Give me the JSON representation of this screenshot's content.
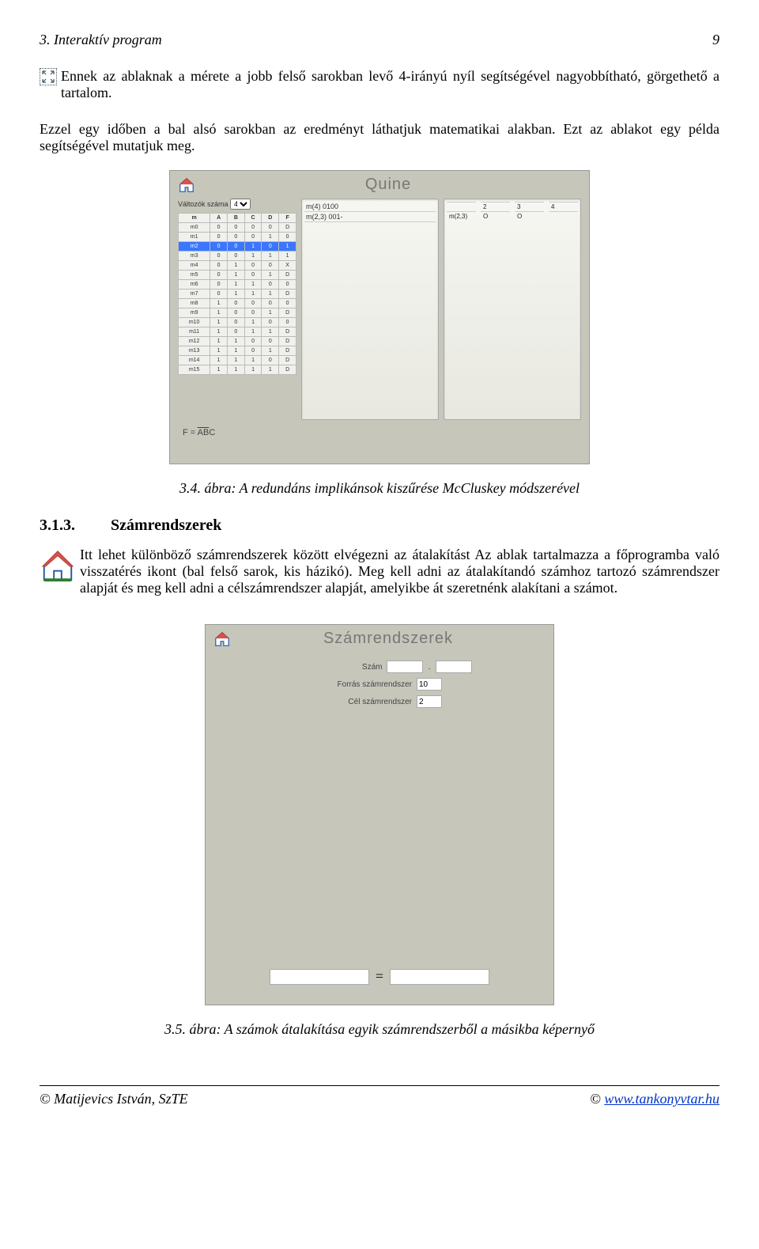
{
  "header": {
    "left": "3. Interaktív program",
    "right": "9"
  },
  "para1": "Ennek az ablaknak a mérete a jobb felső sarokban levő 4-irányú nyíl segítségével nagyobbítható, görgethető a tartalom.",
  "para2": "Ezzel egy időben a bal alsó sarokban az eredményt láthatjuk matematikai alakban. Ezt az ablakot egy példa segítségével mutatjuk meg.",
  "quine": {
    "title": "Quine",
    "var_label": "Változók száma",
    "var_value": "4",
    "truth_headers": [
      "m",
      "A",
      "B",
      "C",
      "D",
      "F"
    ],
    "truth_rows": [
      [
        "m0",
        "0",
        "0",
        "0",
        "0",
        "D"
      ],
      [
        "m1",
        "0",
        "0",
        "0",
        "1",
        "0"
      ],
      [
        "m2",
        "0",
        "0",
        "1",
        "0",
        "1"
      ],
      [
        "m3",
        "0",
        "0",
        "1",
        "1",
        "1"
      ],
      [
        "m4",
        "0",
        "1",
        "0",
        "0",
        "X"
      ],
      [
        "m5",
        "0",
        "1",
        "0",
        "1",
        "D"
      ],
      [
        "m6",
        "0",
        "1",
        "1",
        "0",
        "0"
      ],
      [
        "m7",
        "0",
        "1",
        "1",
        "1",
        "D"
      ],
      [
        "m8",
        "1",
        "0",
        "0",
        "0",
        "0"
      ],
      [
        "m9",
        "1",
        "0",
        "0",
        "1",
        "D"
      ],
      [
        "m10",
        "1",
        "0",
        "1",
        "0",
        "0"
      ],
      [
        "m11",
        "1",
        "0",
        "1",
        "1",
        "D"
      ],
      [
        "m12",
        "1",
        "1",
        "0",
        "0",
        "D"
      ],
      [
        "m13",
        "1",
        "1",
        "0",
        "1",
        "D"
      ],
      [
        "m14",
        "1",
        "1",
        "1",
        "0",
        "D"
      ],
      [
        "m15",
        "1",
        "1",
        "1",
        "1",
        "D"
      ]
    ],
    "highlight_row": 2,
    "panel1_lines": [
      "m(4)  0100",
      "m(2,3)  001-"
    ],
    "panel2_header": [
      "",
      "2",
      "3",
      "4"
    ],
    "panel2_row": [
      "m(2,3)",
      "O",
      "O",
      ""
    ],
    "formula_label": "F  =  ",
    "formula_value_pre_over": "",
    "formula_value_over": "AB",
    "formula_value_post_over": "C"
  },
  "caption1": "3.4. ábra: A redundáns implikánsok kiszűrése McCluskey módszerével",
  "section": {
    "num": "3.1.3.",
    "title": "Számrendszerek"
  },
  "para3": "Itt lehet különböző számrendszerek között elvégezni az átalakítást Az ablak tartalmazza a főprogramba való visszatérés ikont (bal felső sarok, kis házikó). Meg kell adni az átalakítandó számhoz tartozó számrendszer alapját és meg kell adni a célszámrendszer alapját, amelyikbe át szeretnénk alakítani a számot.",
  "szr": {
    "title": "Számrendszerek",
    "label_szam": "Szám",
    "label_forras": "Forrás számrendszer",
    "label_cel": "Cél számrendszer",
    "value_forras": "10",
    "value_cel": "2",
    "equals": "="
  },
  "caption2": "3.5. ábra: A számok átalakítása egyik számrendszerből a másikba képernyő",
  "footer": {
    "left": "© Matijevics István, SzTE",
    "right_prefix": "© ",
    "right_link": "www.tankonyvtar.hu"
  }
}
